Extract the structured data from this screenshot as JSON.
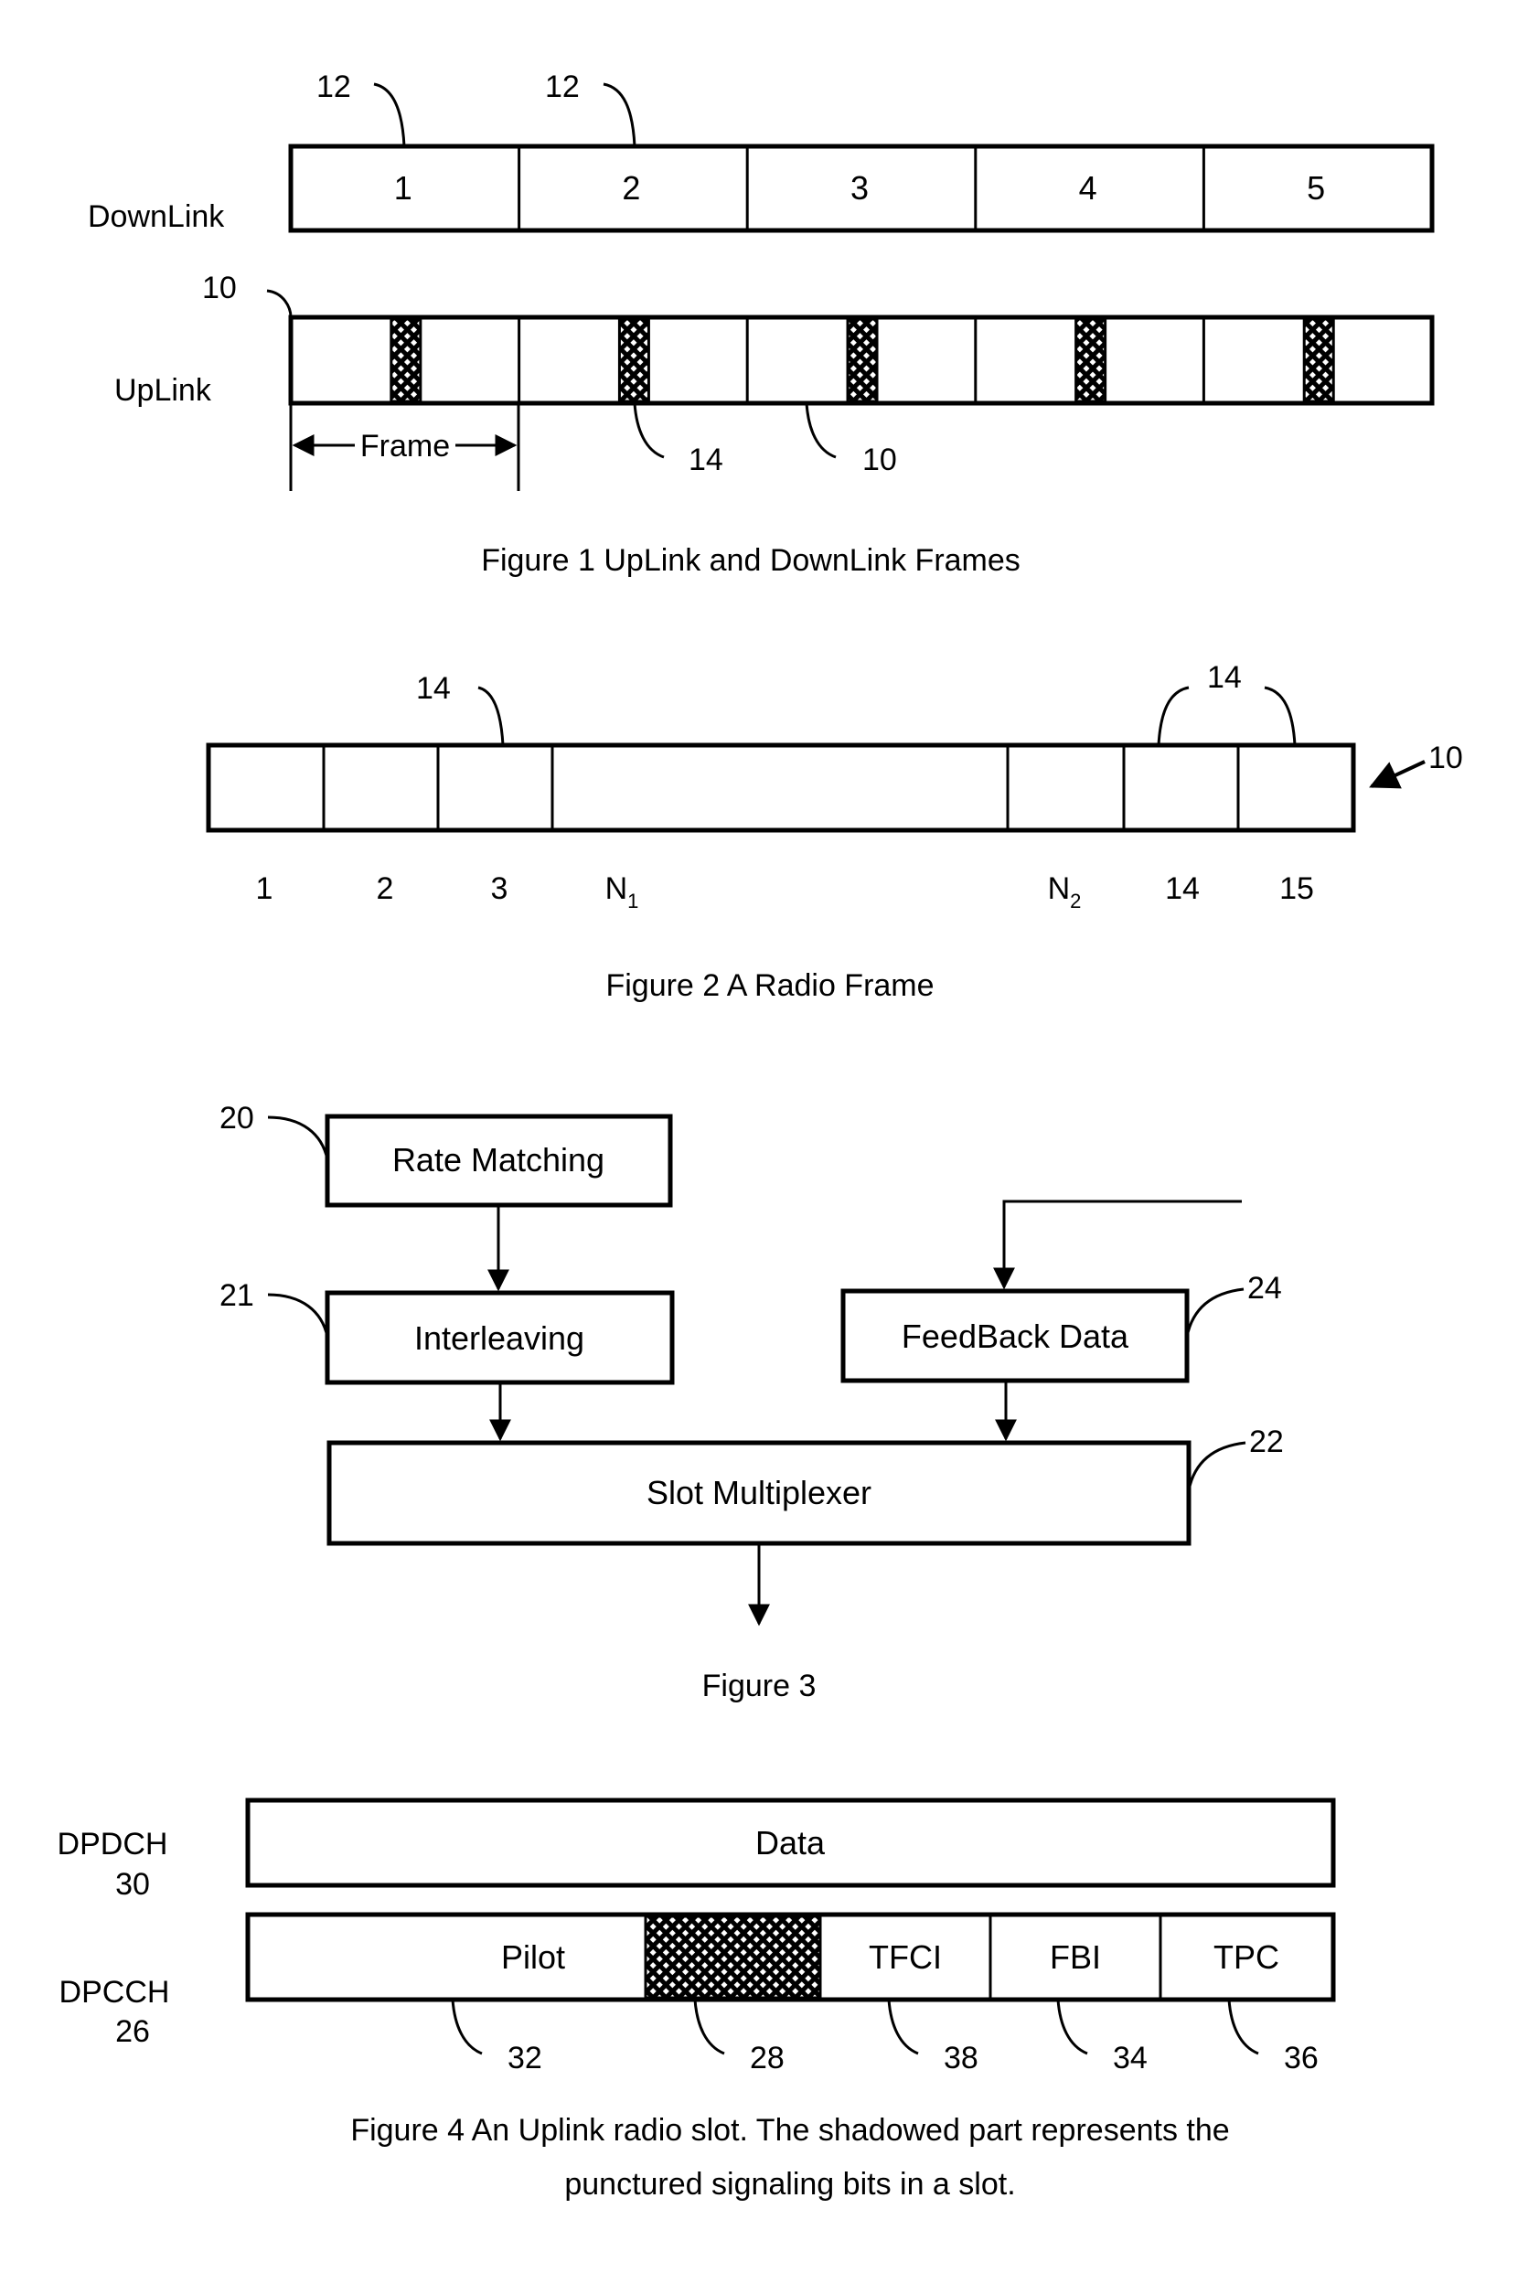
{
  "figure1": {
    "caption": "Figure 1  UpLink and DownLink Frames",
    "downlink_label": "DownLink",
    "uplink_label": "UpLink",
    "downlink_frames": [
      "1",
      "2",
      "3",
      "4",
      "5"
    ],
    "uplink_frame_count": 5,
    "frame_span_label": "Frame",
    "ref_downlink_frame_a": "12",
    "ref_downlink_frame_b": "12",
    "ref_uplink_frame_start": "10",
    "ref_slot": "14",
    "ref_uplink_frame": "10"
  },
  "figure2": {
    "caption": "Figure 2  A Radio Frame",
    "slots": [
      {
        "label": "1"
      },
      {
        "label": "2"
      },
      {
        "label": "3"
      },
      {
        "label": "N",
        "sub": "1"
      },
      {
        "label": "N",
        "sub": "2"
      },
      {
        "label": "14"
      },
      {
        "label": "15"
      }
    ],
    "ref_slot_left": "14",
    "ref_slot_right": "14",
    "ref_frame": "10"
  },
  "figure3": {
    "caption": "Figure 3",
    "blocks": {
      "rate_matching": {
        "label": "Rate Matching",
        "ref": "20"
      },
      "interleaving": {
        "label": "Interleaving",
        "ref": "21"
      },
      "feedback_data": {
        "label": "FeedBack Data",
        "ref": "24"
      },
      "slot_multiplexer": {
        "label": "Slot Multiplexer",
        "ref": "22"
      }
    }
  },
  "figure4": {
    "caption_line1": "Figure 4 An Uplink radio slot.  The shadowed part represents the",
    "caption_line2": "punctured signaling bits in a slot.",
    "dpdch": {
      "name": "DPDCH",
      "ref": "30",
      "field": "Data"
    },
    "dpcch": {
      "name": "DPCCH",
      "ref": "26",
      "fields": [
        {
          "label": "Pilot",
          "ref": "32",
          "shaded": false
        },
        {
          "label": "",
          "ref": "28",
          "shaded": true
        },
        {
          "label": "TFCI",
          "ref": "38",
          "shaded": false
        },
        {
          "label": "FBI",
          "ref": "34",
          "shaded": false
        },
        {
          "label": "TPC",
          "ref": "36",
          "shaded": false
        }
      ]
    }
  }
}
